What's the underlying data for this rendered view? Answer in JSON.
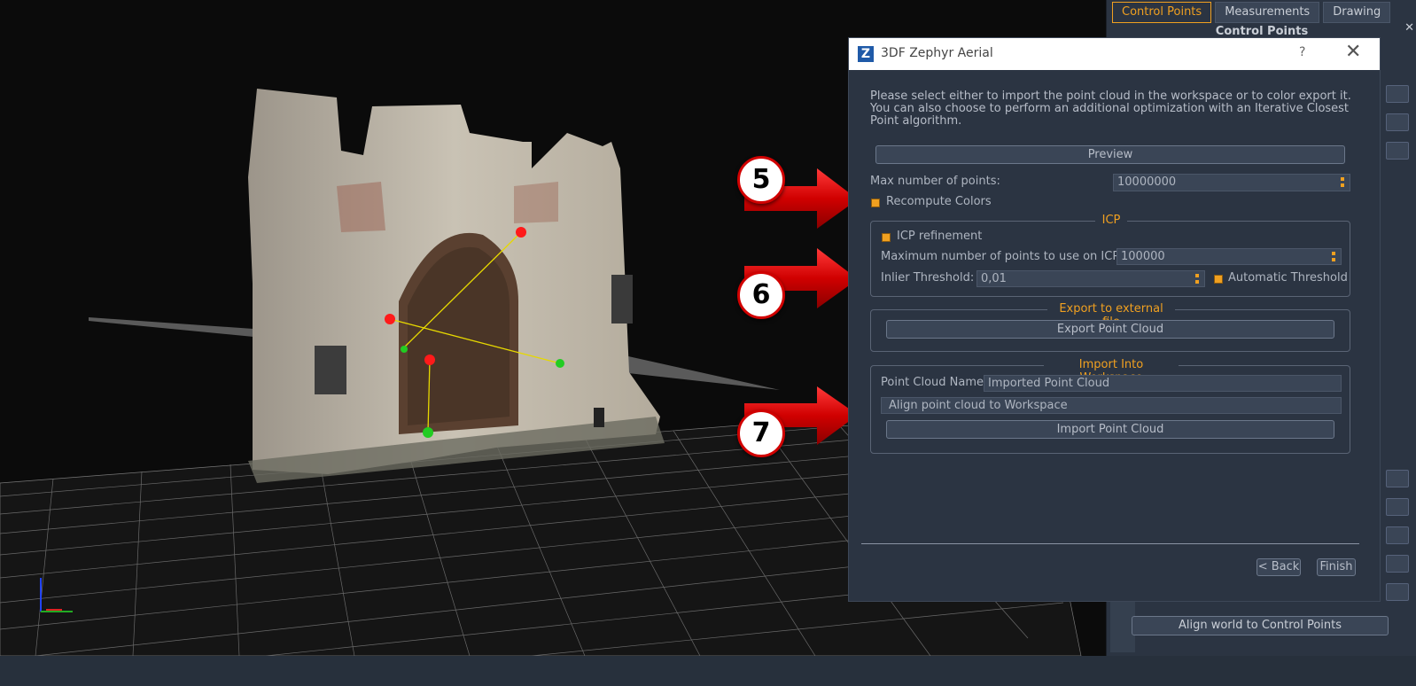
{
  "app": {
    "title": "3DF Zephyr Aerial",
    "logo_letter": "Z",
    "help": "?",
    "close": "✕"
  },
  "right_panel": {
    "tabs": [
      {
        "label": "Control Points",
        "active": true
      },
      {
        "label": "Measurements",
        "active": false
      },
      {
        "label": "Drawing",
        "active": false
      }
    ],
    "title": "Control Points",
    "close": "✕",
    "align_button": "Align world to Control Points"
  },
  "dialog": {
    "description": "Please select either to import the point cloud in the workspace or to color export it. You can also choose to perform an additional optimization with an Iterative Closest Point algorithm.",
    "preview_button": "Preview",
    "max_points_label": "Max number of points:",
    "max_points_value": "10000000",
    "recompute_colors_label": "Recompute Colors",
    "icp": {
      "title": "ICP",
      "refinement_label": "ICP refinement",
      "max_points_label": "Maximum number of points to use on ICP:",
      "max_points_value": "100000",
      "inlier_label": "Inlier Threshold:",
      "inlier_value": "0,01",
      "auto_threshold_label": "Automatic Threshold"
    },
    "export": {
      "title": "Export to external file",
      "button": "Export Point Cloud"
    },
    "import": {
      "title": "Import Into Workspace",
      "name_label": "Point Cloud Name",
      "name_value": "Imported Point Cloud",
      "align_label": "Align point cloud to Workspace",
      "button": "Import Point Cloud"
    },
    "back_button": "< Back",
    "finish_button": "Finish"
  },
  "callouts": [
    "5",
    "6",
    "7"
  ],
  "colors": {
    "accent": "#f0a020",
    "dialog_bg": "#2b3442",
    "callout_red": "#d10000"
  }
}
